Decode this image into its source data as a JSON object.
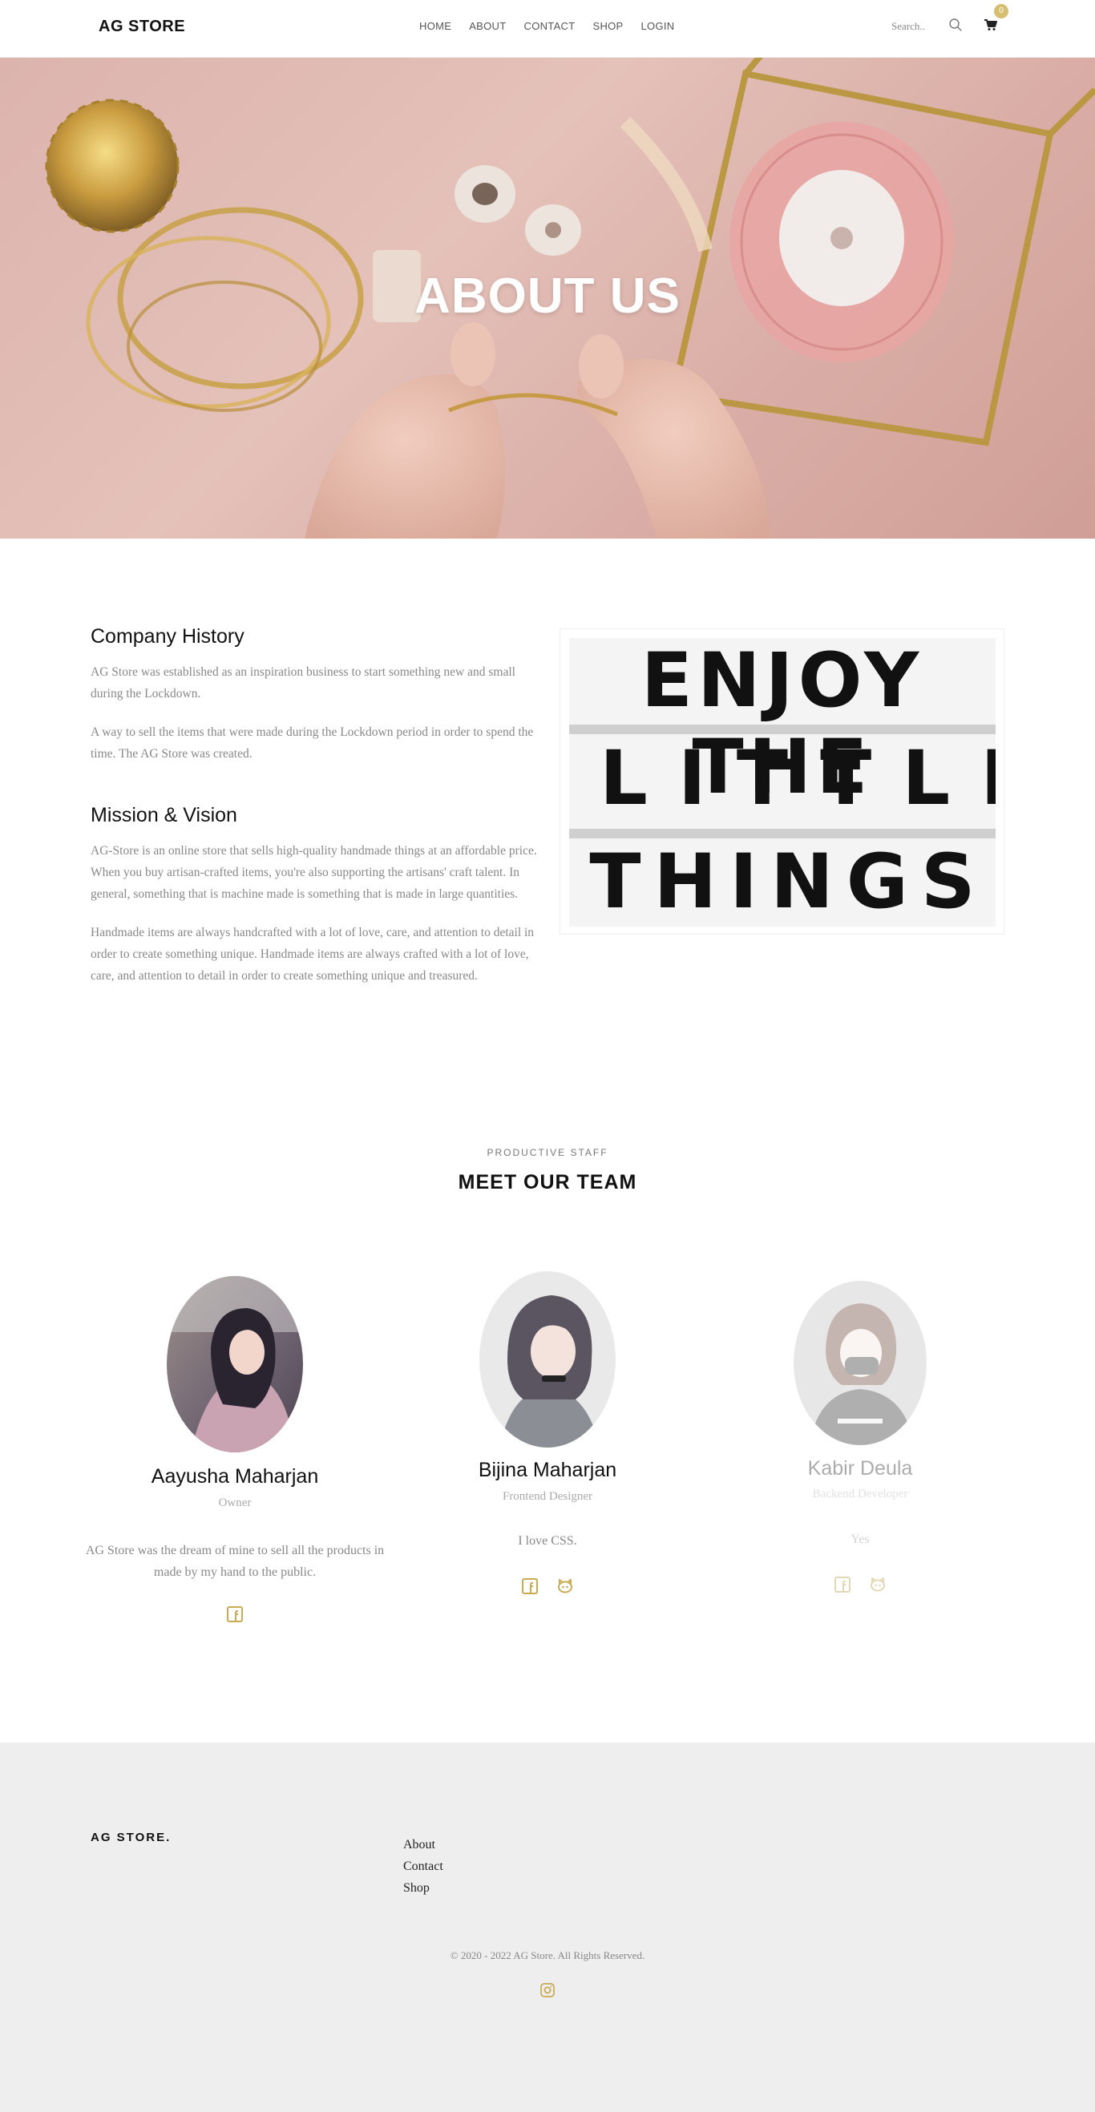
{
  "header": {
    "logo": "AG STORE",
    "nav": [
      "HOME",
      "ABOUT",
      "CONTACT",
      "SHOP",
      "LOGIN"
    ],
    "search_placeholder": "Search..",
    "cart_count": "0"
  },
  "hero": {
    "title": "ABOUT US"
  },
  "history": {
    "title": "Company History",
    "p1": "AG Store was established as an inspiration business to start something new and small during the Lockdown.",
    "p2": "A way to sell the items that were made during the Lockdown period in order to spend the time. The AG Store was created."
  },
  "mission": {
    "title": "Mission & Vision",
    "p1": "AG-Store is an online store that sells high-quality handmade things at an affordable price. When you buy artisan-crafted items, you're also supporting the artisans' craft talent. In general, something that is machine made is something that is made in large quantities.",
    "p2": "Handmade items are always handcrafted with a lot of love, care, and attention to detail in order to create something unique. Handmade items are always crafted with a lot of love, care, and attention to detail in order to create something unique and treasured."
  },
  "sign": {
    "line1": "ENJOY THE",
    "line2": "LITTLE",
    "line3": "THINGS"
  },
  "team": {
    "kicker": "PRODUCTIVE STAFF",
    "title": "MEET OUR TEAM",
    "members": [
      {
        "name": "Aayusha Maharjan",
        "role": "Owner",
        "quote": "AG Store was the dream of mine to sell all the products in made by my hand to the public."
      },
      {
        "name": "Bijina Maharjan",
        "role": "Frontend Designer",
        "quote": "I love CSS."
      },
      {
        "name": "Kabir Deula",
        "role": "Backend Developer",
        "quote": "Yes"
      }
    ]
  },
  "footer": {
    "logo": "AG STORE.",
    "links": [
      "About",
      "Contact",
      "Shop"
    ],
    "copyright": "© 2020 - 2022 AG Store. All Rights Reserved."
  },
  "colors": {
    "accent": "#d7bf71",
    "footer_bg": "#eeeeee",
    "hero_bg": "#dcb4ad"
  },
  "icons": [
    "search-icon",
    "cart-icon",
    "facebook-icon",
    "github-icon",
    "instagram-icon"
  ]
}
